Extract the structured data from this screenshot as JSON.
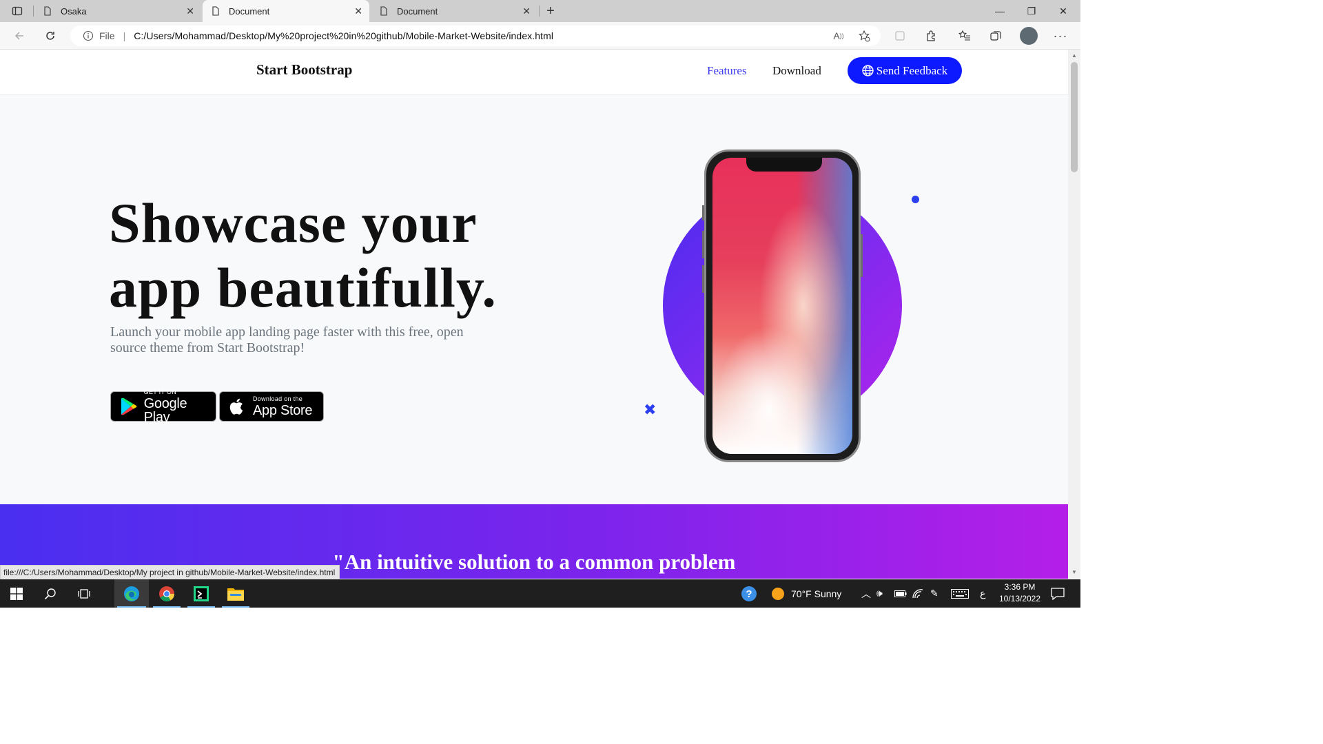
{
  "browser": {
    "tabs": [
      {
        "title": "Osaka",
        "active": false
      },
      {
        "title": "Document",
        "active": true
      },
      {
        "title": "Document",
        "active": false
      }
    ],
    "address": {
      "scheme_label": "File",
      "url": "C:/Users/Mohammad/Desktop/My%20project%20in%20github/Mobile-Market-Website/index.html"
    },
    "status_url": "file:///C:/Users/Mohammad/Desktop/My project in github/Mobile-Market-Website/index.html"
  },
  "page": {
    "brand": "Start Bootstrap",
    "nav": {
      "features": "Features",
      "download": "Download",
      "feedback": "Send Feedback"
    },
    "hero": {
      "title_line1": "Showcase your",
      "title_line2": "app beautifully.",
      "subtitle": "Launch your mobile app landing page faster with this free, open source theme from Start Bootstrap!"
    },
    "badges": {
      "google_small": "GET IT ON",
      "google_big": "Google Play",
      "apple_small": "Download on the",
      "apple_big": "App Store"
    },
    "quote": "\"An intuitive solution to a common problem",
    "colors": {
      "accent": "#0d1aff",
      "gradient_start": "#4a2ff0",
      "gradient_end": "#b41fe8"
    }
  },
  "taskbar": {
    "weather": "70°F  Sunny",
    "ime": "ع",
    "time": "3:36 PM",
    "date": "10/13/2022",
    "icons": [
      "windows-start-icon",
      "search-icon",
      "task-view-icon",
      "edge-icon",
      "chrome-icon",
      "pycharm-icon",
      "file-explorer-icon"
    ]
  }
}
